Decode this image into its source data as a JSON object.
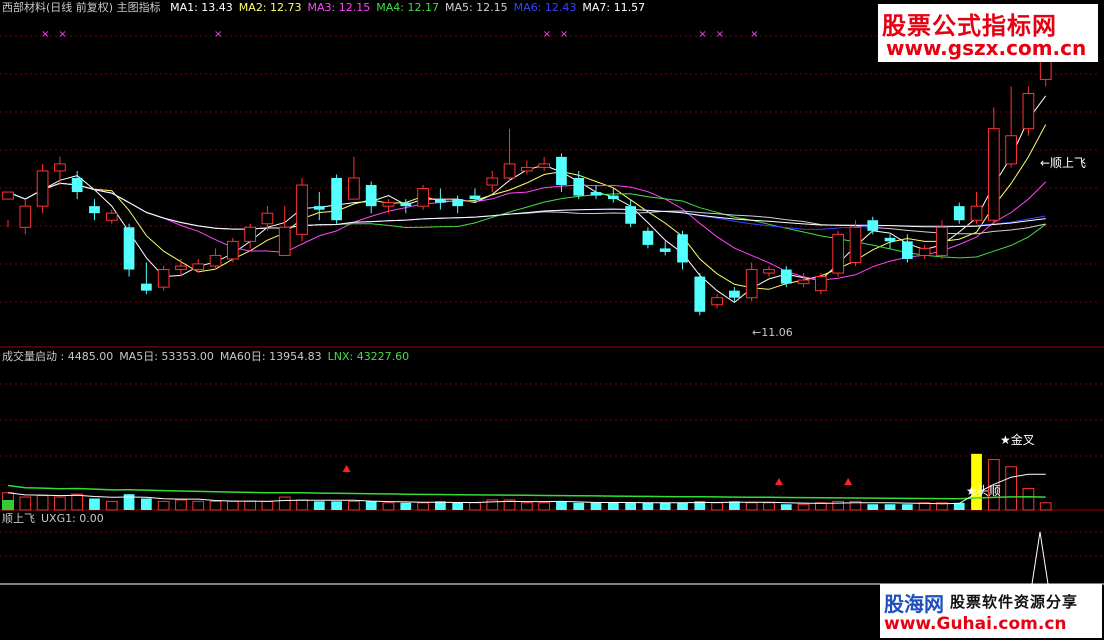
{
  "header_main": {
    "title": "西部材料(日线 前复权) 主图指标",
    "ma": [
      {
        "label": "MA1: 13.43",
        "color": "#ffffff"
      },
      {
        "label": "MA2: 12.73",
        "color": "#ffff66"
      },
      {
        "label": "MA3: 12.15",
        "color": "#ff44ff"
      },
      {
        "label": "MA4: 12.17",
        "color": "#44dd44"
      },
      {
        "label": "MA5: 12.15",
        "color": "#d0d0d0"
      },
      {
        "label": "MA6: 12.43",
        "color": "#3344ff"
      },
      {
        "label": "MA7: 11.57",
        "color": "#ffffff"
      }
    ]
  },
  "header_volume": {
    "items": [
      {
        "label": "成交量启动 : 4485.00",
        "color": "#c8c8c8"
      },
      {
        "label": "MA5日: 53353.00",
        "color": "#c8c8c8"
      },
      {
        "label": "MA60日: 13954.83",
        "color": "#c8c8c8"
      },
      {
        "label": "LNX: 43227.60",
        "color": "#44dd44"
      }
    ]
  },
  "header_signal": {
    "items": [
      {
        "label": "顺上飞",
        "color": "#c8c8c8"
      },
      {
        "label": "UXG1: 0.00",
        "color": "#c8c8c8"
      }
    ]
  },
  "annotations": {
    "peak_label": "←顺上飞",
    "low_label": "←11.06",
    "golden_cross": "★金叉",
    "head_label": "★头顺"
  },
  "watermark_top": {
    "line1": "股票公式指标网",
    "line2": "www.gszx.com.cn"
  },
  "watermark_bottom": {
    "line1": "股海网",
    "line2": "股票软件资源分享",
    "line3": "www.Guhai.com.cn"
  },
  "colors": {
    "up": "#ff3333",
    "down": "#54ffff",
    "grid": "#880000",
    "ma60": "#33dd33"
  },
  "chart_data": {
    "type": "candlestick",
    "price_range": [
      10.2,
      14.9
    ],
    "candles": [
      [
        12.3,
        12.4,
        12.0,
        11.9
      ],
      [
        11.9,
        12.2,
        12.3,
        11.8
      ],
      [
        12.2,
        12.7,
        12.8,
        12.1
      ],
      [
        12.7,
        12.8,
        12.9,
        12.5
      ],
      [
        12.6,
        12.4,
        12.7,
        12.3
      ],
      [
        12.2,
        12.1,
        12.3,
        12.0
      ],
      [
        12.0,
        12.1,
        12.15,
        11.95
      ],
      [
        11.9,
        11.3,
        11.95,
        11.2
      ],
      [
        11.1,
        11.0,
        11.4,
        10.95
      ],
      [
        11.05,
        11.3,
        11.35,
        11.0
      ],
      [
        11.3,
        11.35,
        11.45,
        11.2
      ],
      [
        11.3,
        11.38,
        11.45,
        11.25
      ],
      [
        11.35,
        11.5,
        11.6,
        11.3
      ],
      [
        11.45,
        11.7,
        11.75,
        11.4
      ],
      [
        11.7,
        11.9,
        11.95,
        11.6
      ],
      [
        11.95,
        12.1,
        12.2,
        11.85
      ],
      [
        11.5,
        11.9,
        12.2,
        11.5
      ],
      [
        11.8,
        12.5,
        12.6,
        11.7
      ],
      [
        12.2,
        12.15,
        12.4,
        12.0
      ],
      [
        12.6,
        12.0,
        12.65,
        11.95
      ],
      [
        12.3,
        12.6,
        12.9,
        12.3
      ],
      [
        12.5,
        12.2,
        12.55,
        12.1
      ],
      [
        12.2,
        12.25,
        12.3,
        12.1
      ],
      [
        12.25,
        12.2,
        12.3,
        12.1
      ],
      [
        12.2,
        12.45,
        12.5,
        12.15
      ],
      [
        12.3,
        12.25,
        12.45,
        12.15
      ],
      [
        12.3,
        12.2,
        12.35,
        12.1
      ],
      [
        12.35,
        12.3,
        12.45,
        12.25
      ],
      [
        12.5,
        12.6,
        12.7,
        12.4
      ],
      [
        12.6,
        12.8,
        13.3,
        12.55
      ],
      [
        12.7,
        12.75,
        12.85,
        12.65
      ],
      [
        12.75,
        12.8,
        12.9,
        12.7
      ],
      [
        12.9,
        12.5,
        12.95,
        12.4
      ],
      [
        12.6,
        12.35,
        12.7,
        12.3
      ],
      [
        12.4,
        12.35,
        12.5,
        12.3
      ],
      [
        12.35,
        12.3,
        12.45,
        12.25
      ],
      [
        12.2,
        11.95,
        12.3,
        11.9
      ],
      [
        11.85,
        11.65,
        11.9,
        11.6
      ],
      [
        11.6,
        11.55,
        11.7,
        11.5
      ],
      [
        11.8,
        11.4,
        11.85,
        11.3
      ],
      [
        11.2,
        10.7,
        11.25,
        10.65
      ],
      [
        10.8,
        10.9,
        10.95,
        10.75
      ],
      [
        11.0,
        10.9,
        11.05,
        10.85
      ],
      [
        10.9,
        11.3,
        11.4,
        10.85
      ],
      [
        11.25,
        11.3,
        11.35,
        11.2
      ],
      [
        11.3,
        11.1,
        11.35,
        11.05
      ],
      [
        11.1,
        11.15,
        11.25,
        11.05
      ],
      [
        11.0,
        11.2,
        11.25,
        10.95
      ],
      [
        11.25,
        11.8,
        11.85,
        11.2
      ],
      [
        11.4,
        11.9,
        12.0,
        11.35
      ],
      [
        12.0,
        11.85,
        12.05,
        11.8
      ],
      [
        11.75,
        11.7,
        11.8,
        11.6
      ],
      [
        11.7,
        11.45,
        11.8,
        11.4
      ],
      [
        11.5,
        11.6,
        11.65,
        11.45
      ],
      [
        11.5,
        11.9,
        12.0,
        11.45
      ],
      [
        12.2,
        12.0,
        12.25,
        11.95
      ],
      [
        12.0,
        12.2,
        12.4,
        11.95
      ],
      [
        12.0,
        13.3,
        13.6,
        11.95
      ],
      [
        12.8,
        13.2,
        13.9,
        12.75
      ],
      [
        13.3,
        13.8,
        13.9,
        13.2
      ],
      [
        14.0,
        14.3,
        14.5,
        13.9
      ]
    ],
    "volume_range": [
      0,
      10
    ],
    "volume": [
      1.2,
      0.9,
      1.0,
      0.9,
      1.1,
      0.8,
      0.6,
      1.1,
      0.8,
      0.6,
      0.7,
      0.6,
      0.6,
      0.6,
      0.6,
      0.6,
      0.9,
      0.7,
      0.6,
      0.6,
      0.6,
      0.6,
      0.5,
      0.5,
      0.5,
      0.6,
      0.5,
      0.5,
      0.7,
      0.7,
      0.5,
      0.5,
      0.6,
      0.5,
      0.5,
      0.5,
      0.5,
      0.5,
      0.5,
      0.5,
      0.6,
      0.5,
      0.6,
      0.5,
      0.5,
      0.4,
      0.4,
      0.5,
      0.6,
      0.6,
      0.4,
      0.4,
      0.4,
      0.5,
      0.5,
      0.5,
      3.9,
      3.5,
      3.0,
      1.5,
      0.5
    ],
    "volume_up": [
      true,
      true,
      true,
      true,
      true,
      false,
      true,
      false,
      false,
      true,
      true,
      true,
      true,
      true,
      true,
      true,
      true,
      true,
      false,
      false,
      true,
      false,
      true,
      false,
      true,
      false,
      false,
      true,
      true,
      true,
      true,
      true,
      false,
      false,
      false,
      false,
      false,
      false,
      false,
      false,
      false,
      true,
      false,
      true,
      true,
      false,
      true,
      true,
      true,
      true,
      false,
      false,
      false,
      true,
      true,
      false,
      true,
      true,
      true,
      true,
      true
    ],
    "signal": [
      0,
      0,
      0,
      0,
      0,
      0,
      0,
      0,
      0,
      0,
      0,
      0,
      0,
      0,
      0,
      0,
      0,
      0,
      0,
      0,
      0,
      0,
      0,
      0,
      0,
      0,
      0,
      0,
      0,
      0,
      0,
      0,
      0,
      0,
      0,
      0,
      0,
      0,
      0,
      0,
      0,
      0,
      0,
      0,
      0,
      0,
      0,
      0,
      0,
      0,
      0,
      0,
      0,
      0,
      0,
      0,
      0,
      0,
      1,
      0,
      0
    ]
  }
}
